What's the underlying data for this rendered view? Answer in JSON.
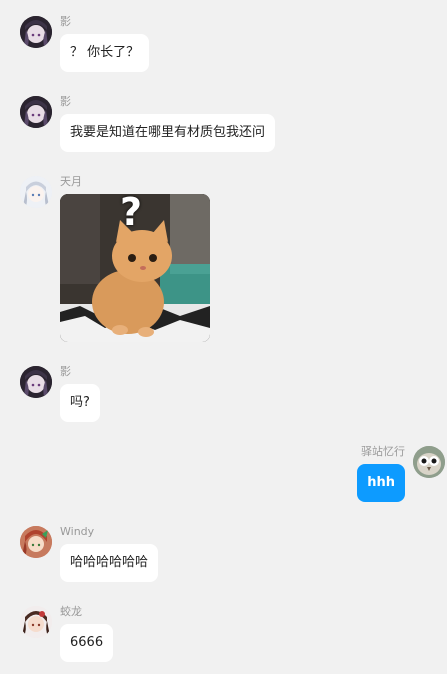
{
  "colors": {
    "background": "#f1f1f1",
    "bubble_other": "#ffffff",
    "bubble_self": "#0d9bff",
    "name_text": "#999999"
  },
  "messages": [
    {
      "sender": "影",
      "avatar": "dark-hair-anime-avatar",
      "type": "text",
      "text": "？ 你长了？"
    },
    {
      "sender": "影",
      "avatar": "dark-hair-anime-avatar",
      "type": "text",
      "text": "我要是知道在哪里有材质包我还问"
    },
    {
      "sender": "天月",
      "avatar": "white-hair-anime-avatar",
      "type": "image",
      "image": "cat-question-mark-meme",
      "overlay_text": "?"
    },
    {
      "sender": "影",
      "avatar": "dark-hair-anime-avatar",
      "type": "text",
      "text": "吗?"
    },
    {
      "sender": "驿站忆行",
      "avatar": "owl-avatar",
      "type": "text",
      "text": "hhh",
      "self": true
    },
    {
      "sender": "Windy",
      "avatar": "red-hair-anime-avatar",
      "type": "text",
      "text": "哈哈哈哈哈哈"
    },
    {
      "sender": "蛟龙",
      "avatar": "brown-hair-anime-avatar",
      "type": "text",
      "text": "6666"
    }
  ]
}
